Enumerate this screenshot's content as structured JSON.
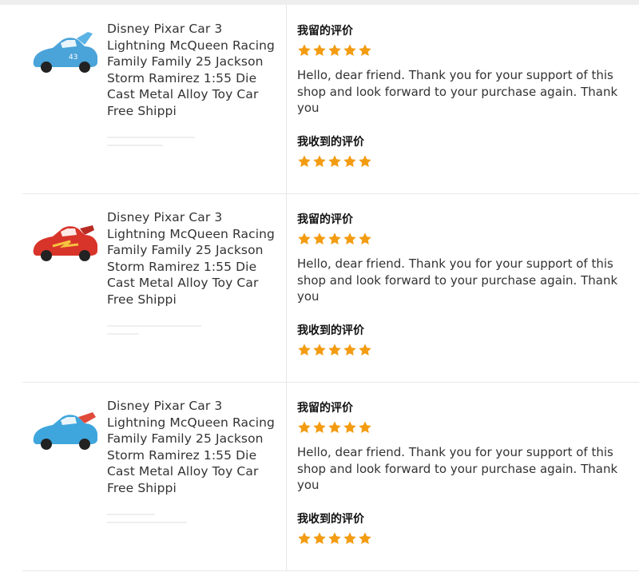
{
  "feedback": {
    "star_color": "#f39c12",
    "rows": [
      {
        "product_title": "Disney Pixar Car 3 Lightning McQueen Racing Family Family 25 Jackson Storm Ramirez 1:55 Die Cast Metal Alloy Toy Car Free Shippi",
        "car_color": "#4aa3d9",
        "left_label": "我留的评价",
        "left_rating": 5,
        "message": "Hello, dear friend. Thank you for your support of this shop and look forward to your purchase again. Thank you",
        "received_label": "我收到的评价",
        "received_rating": 5
      },
      {
        "product_title": "Disney Pixar Car 3 Lightning McQueen Racing Family Family 25 Jackson Storm Ramirez 1:55 Die Cast Metal Alloy Toy Car Free Shippi",
        "car_color": "#d8342a",
        "left_label": "我留的评价",
        "left_rating": 5,
        "message": "Hello, dear friend. Thank you for your support of this shop and look forward to your purchase again. Thank you",
        "received_label": "我收到的评价",
        "received_rating": 5
      },
      {
        "product_title": "Disney Pixar Car 3 Lightning McQueen Racing Family Family 25 Jackson Storm Ramirez 1:55 Die Cast Metal Alloy Toy Car Free Shippi",
        "car_color": "#3fa6dd",
        "left_label": "我留的评价",
        "left_rating": 5,
        "message": "Hello, dear friend. Thank you for your support of this shop and look forward to your purchase again. Thank you",
        "received_label": "我收到的评价",
        "received_rating": 5
      }
    ]
  }
}
